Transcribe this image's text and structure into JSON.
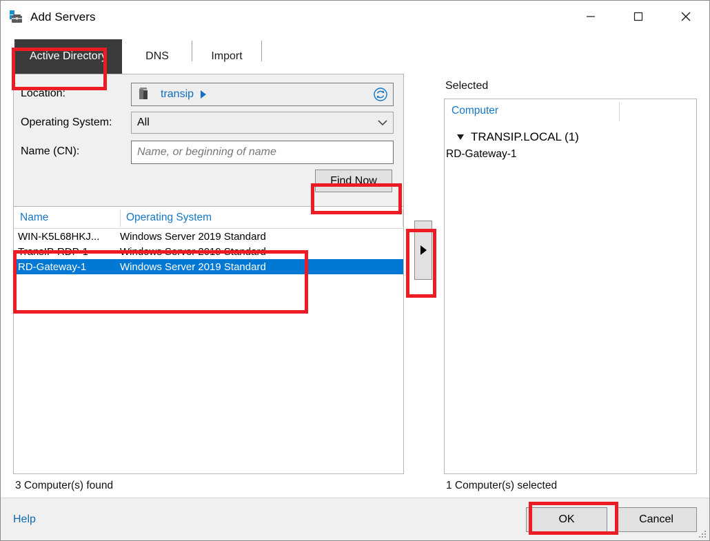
{
  "window": {
    "title": "Add Servers",
    "icon": "server-manager-icon",
    "controls": {
      "minimize": "minimize-icon",
      "maximize": "maximize-icon",
      "close": "close-icon"
    }
  },
  "tabs": [
    {
      "label": "Active Directory",
      "active": true
    },
    {
      "label": "DNS",
      "active": false
    },
    {
      "label": "Import",
      "active": false
    }
  ],
  "query": {
    "location": {
      "label": "Location:",
      "value": "transip",
      "icon": "domain-container-icon",
      "caret": "caret-right-icon",
      "refresh": "refresh-icon"
    },
    "operating_system": {
      "label": "Operating System:",
      "value": "All",
      "chevron": "⌄"
    },
    "name_cn": {
      "label": "Name (CN):",
      "value": "",
      "placeholder": "Name, or beginning of name"
    },
    "find_now": "Find Now"
  },
  "results": {
    "columns": [
      "Name",
      "Operating System"
    ],
    "rows": [
      {
        "name": "WIN-K5L68HKJ...",
        "os": "Windows Server 2019 Standard",
        "selected": false
      },
      {
        "name": "TransIP-RDP-1",
        "os": "Windows Server 2019 Standard",
        "selected": false
      },
      {
        "name": "RD-Gateway-1",
        "os": "Windows Server 2019 Standard",
        "selected": true
      }
    ],
    "status": "3 Computer(s) found"
  },
  "transfer": {
    "add_button": "add-selected-button",
    "arrow": "caret-right-icon"
  },
  "selected_panel": {
    "caption": "Selected",
    "column": "Computer",
    "tree": {
      "node": "TRANSIP.LOCAL (1)",
      "expander": "triangle-expanded-icon",
      "children": [
        "RD-Gateway-1"
      ]
    },
    "status": "1 Computer(s) selected"
  },
  "footer": {
    "help": "Help",
    "ok": "OK",
    "cancel": "Cancel"
  },
  "colors": {
    "accent_blue": "#0078d4",
    "link_blue": "#1577c6",
    "tab_active_bg": "#3a3a3a",
    "annotation_red": "#ed1c24",
    "panel_bg": "#f0f0f0"
  },
  "annotations": [
    {
      "name": "active-directory-tab-highlight"
    },
    {
      "name": "find-now-highlight"
    },
    {
      "name": "results-rows-highlight"
    },
    {
      "name": "add-button-highlight"
    },
    {
      "name": "ok-button-highlight"
    }
  ]
}
